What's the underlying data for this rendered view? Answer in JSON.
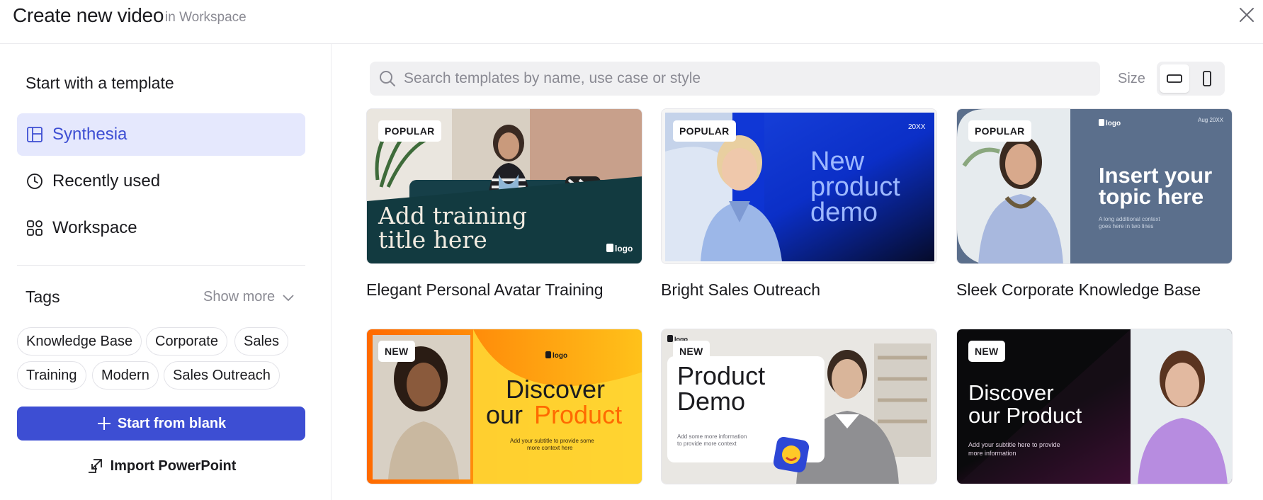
{
  "header": {
    "title": "Create new video",
    "subtitle": "in Workspace"
  },
  "sidebar": {
    "heading": "Start with a template",
    "nav": [
      {
        "label": "Synthesia",
        "icon": "layout-icon",
        "active": true
      },
      {
        "label": "Recently used",
        "icon": "clock-icon",
        "active": false
      },
      {
        "label": "Workspace",
        "icon": "grid-icon",
        "active": false
      }
    ],
    "tags_heading": "Tags",
    "show_more": "Show more",
    "tags": [
      "Knowledge Base",
      "Corporate",
      "Sales",
      "Training",
      "Modern",
      "Sales Outreach"
    ],
    "start_blank": "Start from blank",
    "import_ppt": "Import PowerPoint"
  },
  "main": {
    "search_placeholder": "Search templates by name, use case or style",
    "size_label": "Size",
    "size_options": [
      "landscape-icon",
      "portrait-icon"
    ],
    "templates": [
      {
        "title": "Elegant Personal Avatar Training",
        "badge": "POPULAR",
        "thumb_text": [
          "Add training",
          "title here"
        ],
        "logo": "logo",
        "colors": {
          "bg": "#123a40",
          "photo": "#d9d2c6"
        }
      },
      {
        "title": "Bright Sales Outreach",
        "badge": "POPULAR",
        "thumb_text": [
          "New",
          "product",
          "demo"
        ],
        "corner_text": "20XX",
        "colors": {
          "bg": "#0b2fc7",
          "dark": "#050b2a"
        }
      },
      {
        "title": "Sleek Corporate Knowledge Base",
        "badge": "POPULAR",
        "thumb_text": [
          "Insert your",
          "topic here"
        ],
        "small_text": [
          "A long additional context",
          "goes here in two lines"
        ],
        "logo": "logo",
        "corner_text": "Aug 20XX",
        "colors": {
          "bg": "#5b6f8c"
        }
      },
      {
        "title": "",
        "badge": "NEW",
        "thumb_text": [
          "Discover",
          "our",
          "Product"
        ],
        "small_text": [
          "Add your subtitle to provide some",
          "more context here"
        ],
        "logo": "logo",
        "colors": {
          "bg": "#ffb21a",
          "accent": "#ff6a00"
        }
      },
      {
        "title": "",
        "badge": "NEW",
        "thumb_text": [
          "Product",
          "Demo"
        ],
        "small_text": [
          "Add some more information",
          "to provide more context"
        ],
        "logo": "logo",
        "colors": {
          "bg": "#e9e7e3",
          "card": "#ffffff",
          "accent": "#2d47d6"
        }
      },
      {
        "title": "",
        "badge": "NEW",
        "thumb_text": [
          "Discover",
          "our Product"
        ],
        "small_text": [
          "Add your subtitle here to provide",
          "more information"
        ],
        "colors": {
          "bg": "#0a0a0c",
          "accent": "#a0117a"
        }
      }
    ]
  }
}
